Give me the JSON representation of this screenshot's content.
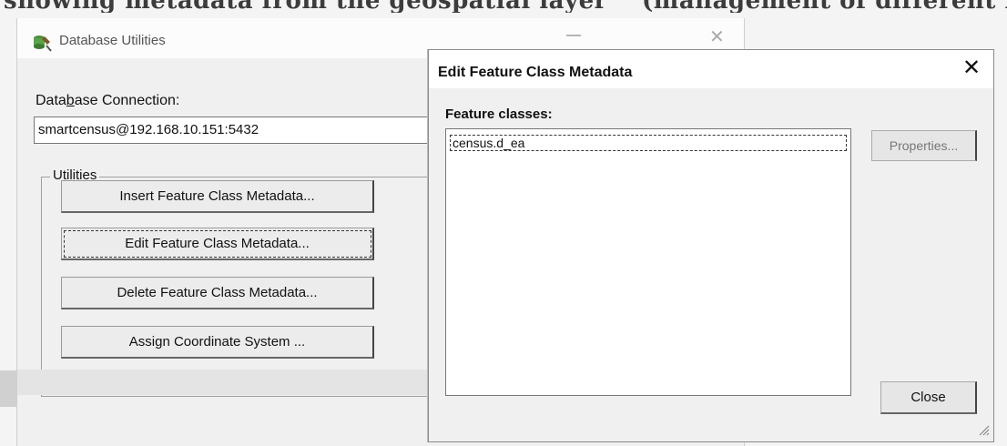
{
  "document_text": {
    "left": "showing metadata from the geospatial layer",
    "right": "(management of different la"
  },
  "background_dialog": {
    "title": "Database Utilities",
    "app_icon": "database-tool-icon",
    "close_glyph": "✕",
    "connection_label_prefix": "Data",
    "connection_label_underlined": "b",
    "connection_label_suffix": "ase Connection:",
    "connection_value": "smartcensus@192.168.10.151:5432",
    "utilities_label": "Utilities",
    "buttons": [
      {
        "label": "Insert Feature Class Metadata..."
      },
      {
        "label": "Edit Feature Class Metadata..."
      },
      {
        "label": "Delete Feature Class Metadata..."
      },
      {
        "label": "Assign Coordinate System ..."
      }
    ]
  },
  "edit_dialog": {
    "title": "Edit Feature Class Metadata",
    "close_glyph": "✕",
    "feature_classes_label": "Feature classes:",
    "feature_classes": [
      "census.d_ea"
    ],
    "properties_label": "Properties...",
    "close_label": "Close"
  }
}
